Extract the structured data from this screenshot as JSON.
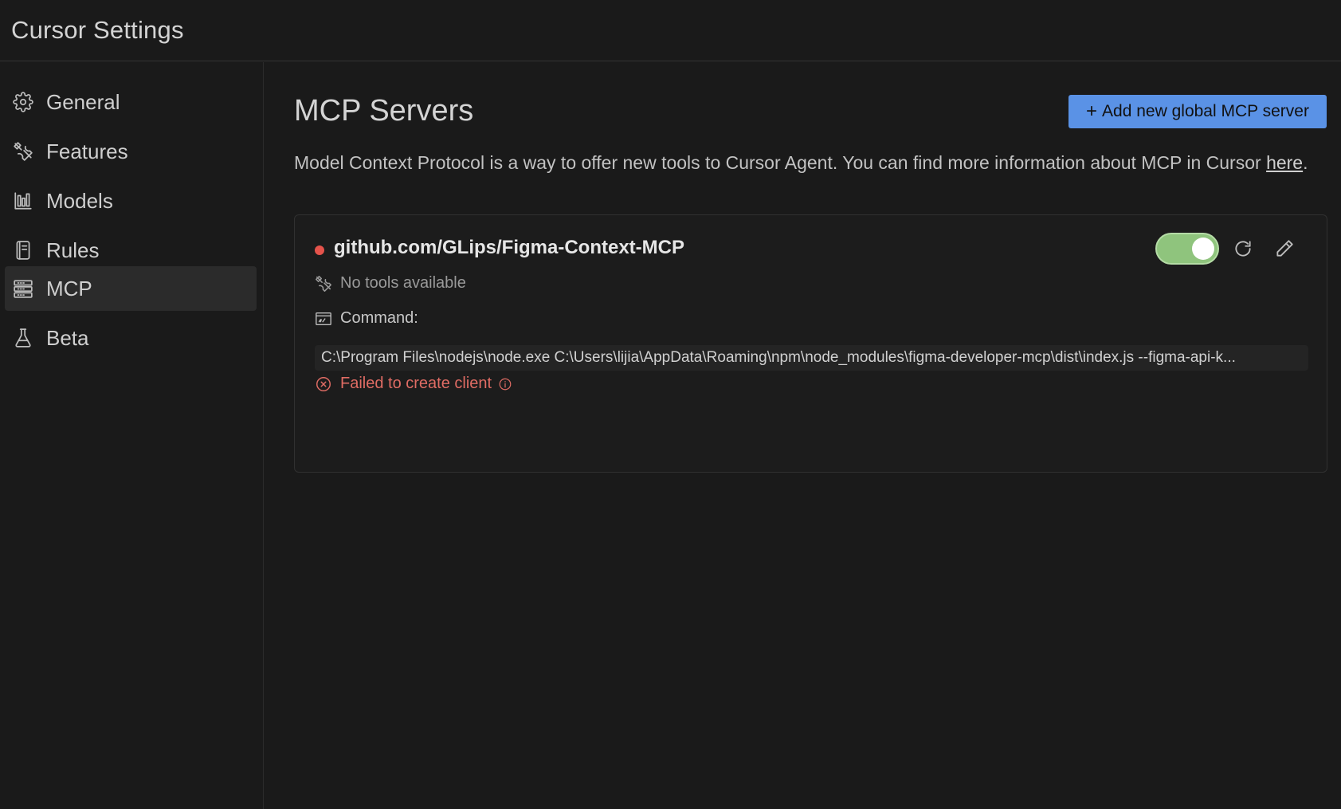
{
  "window": {
    "title": "Cursor Settings"
  },
  "sidebar": {
    "items": [
      {
        "label": "General",
        "icon": "gear-icon",
        "active": false
      },
      {
        "label": "Features",
        "icon": "tools-icon",
        "active": false
      },
      {
        "label": "Models",
        "icon": "bar-chart-icon",
        "active": false
      },
      {
        "label": "Rules",
        "icon": "book-icon",
        "active": false
      },
      {
        "label": "MCP",
        "icon": "server-icon",
        "active": true
      },
      {
        "label": "Beta",
        "icon": "flask-icon",
        "active": false
      }
    ]
  },
  "main": {
    "title": "MCP Servers",
    "add_button": {
      "icon": "plus",
      "label": "Add new global MCP server"
    },
    "description": "Model Context Protocol is a way to offer new tools to Cursor Agent. You can find more information about MCP in Cursor",
    "description_link": "here",
    "description_suffix": ".",
    "servers": [
      {
        "name": "github.com/GLips/Figma-Context-MCP",
        "status": "error",
        "status_color": "#e5534b",
        "enabled": true,
        "tools_text": "No tools available",
        "command_label": "Command:",
        "command": "C:\\Program Files\\nodejs\\node.exe C:\\Users\\lijia\\AppData\\Roaming\\npm\\node_modules\\figma-developer-mcp\\dist\\index.js --figma-api-k...",
        "error_text": "Failed to create client"
      }
    ]
  },
  "colors": {
    "background": "#1a1a1a",
    "accent": "#5a92e6",
    "toggle_on": "#8fc47d",
    "error": "#e06c64"
  }
}
